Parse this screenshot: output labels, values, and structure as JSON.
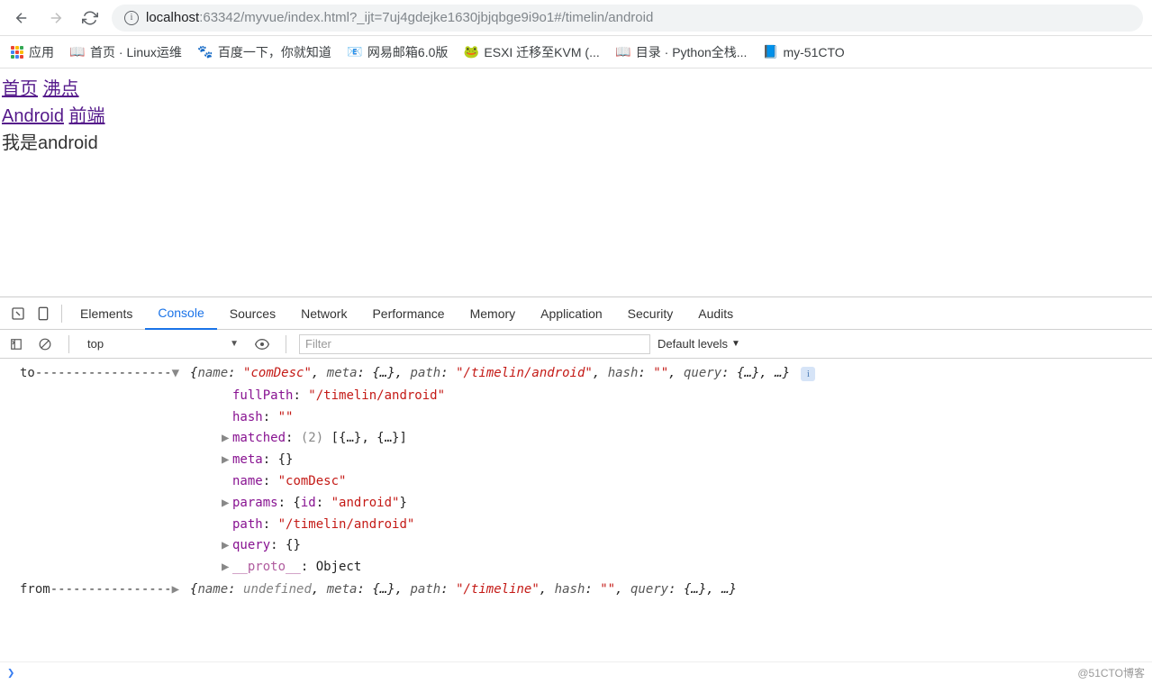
{
  "browser": {
    "url_host": "localhost",
    "url_rest": ":63342/myvue/index.html?_ijt=7uj4gdejke1630jbjqbge9i9o1#/timelin/android"
  },
  "bookmarks": {
    "apps": "应用",
    "items": [
      {
        "icon": "📖",
        "label": "首页 · Linux运维"
      },
      {
        "icon": "🐾",
        "label": "百度一下，你就知道"
      },
      {
        "icon": "📧",
        "label": "网易邮箱6.0版"
      },
      {
        "icon": "🐸",
        "label": "ESXI 迁移至KVM (..."
      },
      {
        "icon": "📖",
        "label": "目录 · Python全栈..."
      },
      {
        "icon": "📘",
        "label": "my-51CTO"
      }
    ]
  },
  "page": {
    "nav1": {
      "home": "首页",
      "boil": "沸点"
    },
    "nav2": {
      "android": "Android",
      "frontend": "前端"
    },
    "content": "我是android"
  },
  "devtools": {
    "tabs": [
      "Elements",
      "Console",
      "Sources",
      "Network",
      "Performance",
      "Memory",
      "Application",
      "Security",
      "Audits"
    ],
    "active_tab": "Console",
    "context": "top",
    "filter_placeholder": "Filter",
    "levels": "Default levels"
  },
  "console": {
    "to_label": "to------------------",
    "to_preview": {
      "name": "comDesc",
      "path": "/timelin/android",
      "hash": ""
    },
    "to_props": {
      "fullPath": "/timelin/android",
      "hash": "",
      "matched_count": "(2)",
      "matched_preview": "[{…}, {…}]",
      "meta": "{}",
      "name": "comDesc",
      "params_id": "android",
      "path": "/timelin/android",
      "query": "{}",
      "proto": "Object"
    },
    "from_label": "from----------------",
    "from_preview": {
      "name": "undefined",
      "path": "/timeline",
      "hash": ""
    }
  },
  "watermark": "@51CTO博客"
}
